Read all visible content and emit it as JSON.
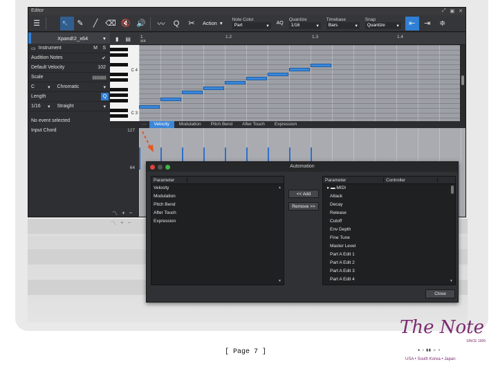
{
  "editor": {
    "title": "Editor",
    "toolbar": {
      "action_label": "Action",
      "note_color": {
        "label": "Note Color",
        "value": "Part"
      },
      "aq_label": "AQ",
      "quantize": {
        "label": "Quantize",
        "value": "1/16"
      },
      "timebase": {
        "label": "Timebase",
        "value": "Bars"
      },
      "snap": {
        "label": "Snap",
        "value": "Quantize"
      }
    },
    "instrument_select": "Xpand!2_x64",
    "inspector": {
      "instrument_label": "Instrument",
      "m_label": "M",
      "s_label": "S",
      "audition_label": "Audition Notes",
      "velocity_label": "Default Velocity",
      "velocity_value": "102",
      "scale_label": "Scale",
      "scale_root": "C",
      "scale_type": "Chromatic",
      "length_label": "Length",
      "length_value": "1/16",
      "length_mode": "Straight",
      "q_label": "Q",
      "no_event": "No event selected",
      "input_chord": "Input Chord"
    },
    "ruler": [
      "1",
      "1.2",
      "1.3",
      "1.4"
    ],
    "ruler_sub": "4/4",
    "keys": {
      "c4": "C 4",
      "c3": "C 3"
    },
    "tabs": [
      "Velocity",
      "Modulation",
      "Pitch Bend",
      "After Touch",
      "Expression"
    ],
    "velocity_axis": {
      "max": "127",
      "mid": "64"
    }
  },
  "automation": {
    "title": "Automation",
    "left_header": {
      "parameter": "Parameter"
    },
    "left_items": [
      "Velocity",
      "Modulation",
      "Pitch Bend",
      "After Touch",
      "Expression"
    ],
    "add_button": "<< Add",
    "remove_button": "Remove >>",
    "right_header": {
      "parameter": "Parameter",
      "controller": "Controller"
    },
    "right_root": "MIDI",
    "right_items": [
      "Attack",
      "Decay",
      "Release",
      "Cutoff",
      "Env Depth",
      "Fine Tune",
      "Master Level",
      "Part A Edit 1",
      "Part A Edit 2",
      "Part A Edit 3",
      "Part A Edit 4"
    ],
    "close_button": "Close"
  },
  "footer": {
    "page": "[ Page 7 ]",
    "logo_text": "The Note",
    "logo_since": "SINCE 1999",
    "logo_tag": "USA • South Korea • Japan"
  },
  "colors": {
    "accent": "#2f7fd4",
    "note_fill": "#3b86d8",
    "logo": "#7b2b6f",
    "arrow": "#e8571f"
  }
}
